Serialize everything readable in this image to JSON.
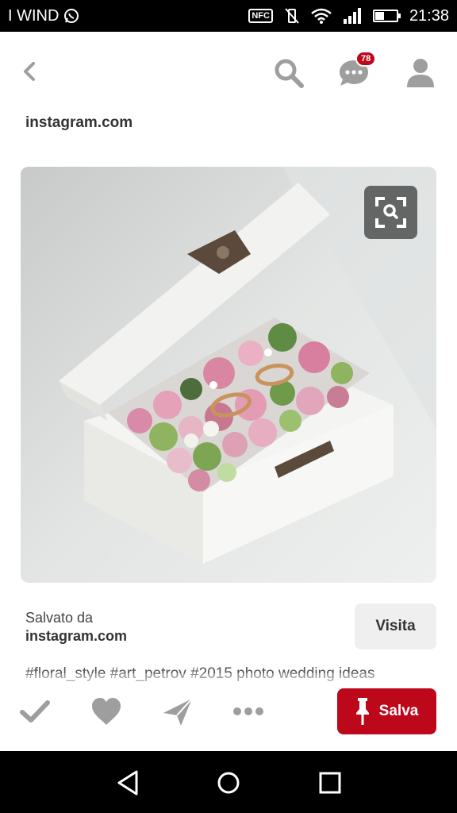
{
  "status_bar": {
    "carrier": "I WIND",
    "nfc": "NFC",
    "time": "21:38",
    "battery_level": 0.4
  },
  "header": {
    "back_icon": "chevron-left-icon",
    "search_icon": "search-icon",
    "messages_icon": "chat-bubble-icon",
    "messages_badge": "78",
    "profile_icon": "person-icon"
  },
  "pin": {
    "source_domain": "instagram.com",
    "image_subject": "white wooden ring box with flowers and rings",
    "visual_search_icon": "visual-search-icon"
  },
  "saved": {
    "label": "Salvato da",
    "source": "instagram.com",
    "visit_label": "Visita"
  },
  "description": "#floral_style #art_petrov #2015 photo wedding ideas",
  "actions": {
    "done_icon": "check-icon",
    "like_icon": "heart-icon",
    "send_icon": "send-icon",
    "more_icon": "more-icon",
    "save_label": "Salva",
    "save_icon": "pin-icon"
  },
  "colors": {
    "brand_red": "#bd081c",
    "icon_gray": "#9e9e9e"
  }
}
